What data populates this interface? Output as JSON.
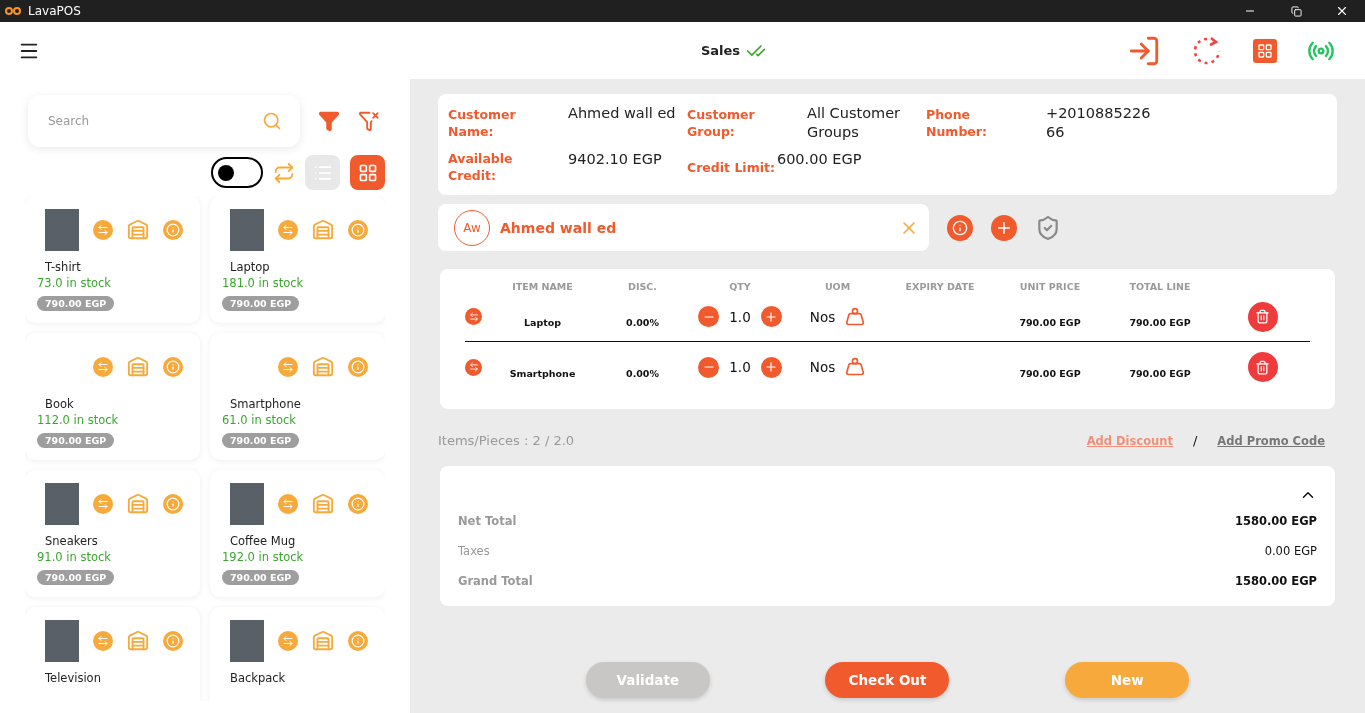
{
  "window": {
    "title": "LavaPOS"
  },
  "header": {
    "title": "Sales"
  },
  "search": {
    "placeholder": "Search"
  },
  "toggle": {
    "on": false
  },
  "view_modes": [
    {
      "kind": "list",
      "selected": false
    },
    {
      "kind": "grid",
      "selected": true
    }
  ],
  "products": [
    {
      "name": "T-shirt",
      "stock": "73.0 in stock",
      "price": "790.00 EGP",
      "image": true
    },
    {
      "name": "Laptop",
      "stock": "181.0 in stock",
      "price": "790.00 EGP",
      "image": true
    },
    {
      "name": "Book",
      "stock": "112.0 in stock",
      "price": "790.00 EGP",
      "image": false
    },
    {
      "name": "Smartphone",
      "stock": "61.0 in stock",
      "price": "790.00 EGP",
      "image": false
    },
    {
      "name": "Sneakers",
      "stock": "91.0 in stock",
      "price": "790.00 EGP",
      "image": true
    },
    {
      "name": "Coffee Mug",
      "stock": "192.0 in stock",
      "price": "790.00 EGP",
      "image": true
    },
    {
      "name": "Television",
      "image": true
    },
    {
      "name": "Backpack",
      "image": true
    }
  ],
  "customer_info": [
    {
      "label": "Customer Name:",
      "value": "Ahmed wall ed"
    },
    {
      "label": "Customer Group:",
      "value": "All Customer Groups"
    },
    {
      "label": "Phone Number:",
      "value": "+201088522666"
    },
    {
      "label": "Available Credit:",
      "value": "9402.10 EGP"
    },
    {
      "label": "Credit Limit:",
      "value": "600.00 EGP"
    }
  ],
  "customer_chip": {
    "initials": "Aw",
    "name": "Ahmed wall ed"
  },
  "cart": {
    "columns": [
      "ITEM NAME",
      "DISC.",
      "QTY",
      "UOM",
      "EXPIRY DATE",
      "UNIT PRICE",
      "TOTAL LINE"
    ],
    "rows": [
      {
        "name": "Laptop",
        "disc": "0.00%",
        "qty": "1.0",
        "uom": "Nos",
        "unit_price": "790.00 EGP",
        "total": "790.00 EGP"
      },
      {
        "name": "Smartphone",
        "disc": "0.00%",
        "qty": "1.0",
        "uom": "Nos",
        "unit_price": "790.00 EGP",
        "total": "790.00 EGP"
      }
    ]
  },
  "items_count": "Items/Pieces : 2 / 2.0",
  "add_discount": "Add Discount",
  "separator": "/",
  "add_promo": "Add Promo Code",
  "summary": {
    "expanded": true,
    "rows": [
      {
        "kind": "total",
        "label": "Net Total",
        "value": "1580.00 EGP"
      },
      {
        "kind": "tax",
        "label": "Taxes",
        "value": "0.00 EGP"
      },
      {
        "kind": "total",
        "label": "Grand Total",
        "value": "1580.00 EGP"
      }
    ]
  },
  "actions": [
    {
      "kind": "validate",
      "label": "Validate",
      "disabled": true
    },
    {
      "kind": "checkout",
      "label": "Check Out",
      "disabled": false
    },
    {
      "kind": "new",
      "label": "New",
      "disabled": false
    }
  ]
}
